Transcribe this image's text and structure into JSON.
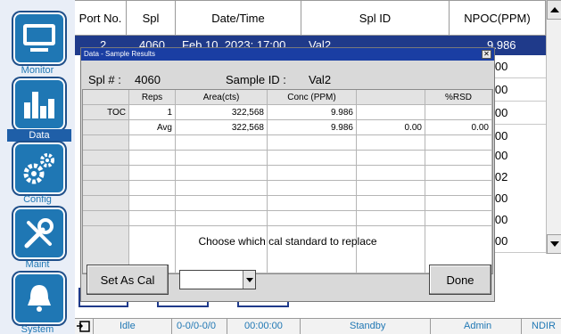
{
  "sidebar": {
    "items": [
      {
        "label": "Monitor",
        "icon": "monitor-icon"
      },
      {
        "label": "Data",
        "icon": "bar-chart-icon"
      },
      {
        "label": "Config",
        "icon": "gears-icon"
      },
      {
        "label": "Maint",
        "icon": "wrench-screwdriver-icon"
      },
      {
        "label": "System",
        "icon": "bell-icon"
      }
    ],
    "active": "Data"
  },
  "table": {
    "columns": [
      "Port No.",
      "Spl",
      "Date/Time",
      "Spl ID",
      "NPOC(PPM)"
    ],
    "selected_row": {
      "port": "2",
      "spl": "4060",
      "datetime": "Feb 10, 2023; 17:00",
      "spl_id": "Val2",
      "npoc": "9.986"
    },
    "npoc_visible": [
      ".000",
      ".000",
      ".000",
      ".000",
      ".000",
      ".002",
      ".000",
      ".000",
      ".000"
    ]
  },
  "dialog": {
    "title": "Data - Sample Results",
    "spl_label": "Spl # :",
    "spl_value": "4060",
    "sample_id_label": "Sample ID :",
    "sample_id_value": "Val2",
    "grid": {
      "headers": [
        "",
        "Reps",
        "Area(cts)",
        "Conc (PPM)",
        "",
        "%RSD"
      ],
      "rows": [
        [
          "TOC",
          "1",
          "322,568",
          "9.986",
          "",
          ""
        ],
        [
          "",
          "Avg",
          "322,568",
          "9.986",
          "0.00",
          "0.00"
        ]
      ]
    },
    "prompt": "Choose which cal standard to replace",
    "set_as_cal": "Set As Cal",
    "done": "Done",
    "combo_value": ""
  },
  "status": {
    "state": "Idle",
    "position": "0-0/0-0/0",
    "time": "00:00:00",
    "mode": "Standby",
    "user": "Admin",
    "ndir": "NDIR"
  },
  "colors": {
    "accent": "#1f77b4",
    "selection": "#1f3a8a",
    "dialog_title": "#1a3ea3"
  }
}
